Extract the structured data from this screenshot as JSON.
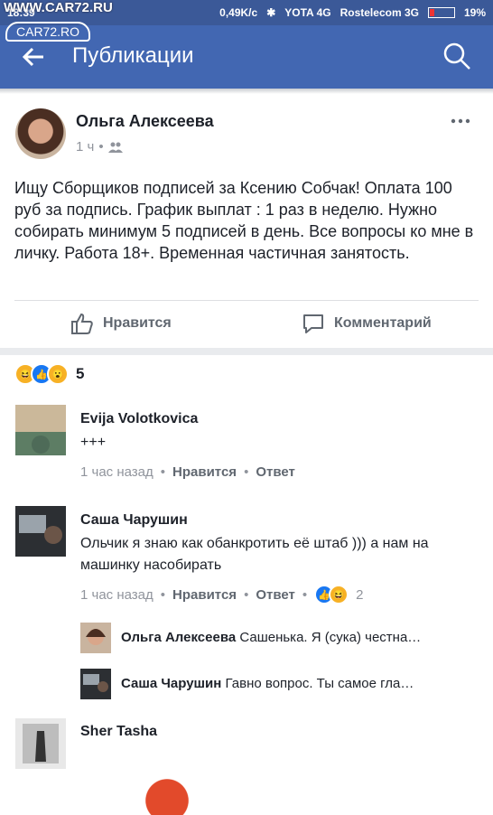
{
  "status_bar": {
    "time": "18:39",
    "speed": "0,49K/c",
    "carrier1": "YOTA 4G",
    "carrier2": "Rostelecom 3G",
    "battery": "19%",
    "battery_level": 0.19
  },
  "watermark": {
    "top": "WWW.CAR72.RU",
    "logo": "CAR72.RO"
  },
  "appbar": {
    "title": "Публикации"
  },
  "post": {
    "author": "Ольга Алексеева",
    "time": "1 ч",
    "text": "Ищу Сборщиков подписей за Ксению Собчак! Оплата 100 руб за подпись. График выплат : 1 раз в неделю. Нужно собирать минимум 5 подписей в день. Все вопросы ко мне в личку. Работа 18+. Временная частичная занятость.",
    "like_label": "Нравится",
    "comment_label": "Комментарий",
    "reaction_count": "5"
  },
  "comments": [
    {
      "name": "Evija Volotkovica",
      "text": "+++",
      "time": "1 час назад",
      "like": "Нравится",
      "reply": "Ответ"
    },
    {
      "name": "Саша Чарушин",
      "text": "Ольчик я знаю как обанкротить её штаб ))) а нам на машинку насобирать",
      "time": "1 час назад",
      "like": "Нравится",
      "reply": "Ответ",
      "reactions": "2"
    },
    {
      "name": "Sher Tasha"
    }
  ],
  "replies": [
    {
      "name": "Ольга Алексеева",
      "text": "Сашенька. Я (сука) честна…"
    },
    {
      "name": "Саша Чарушин",
      "text": "Гавно вопрос. Ты самое гла…"
    }
  ]
}
